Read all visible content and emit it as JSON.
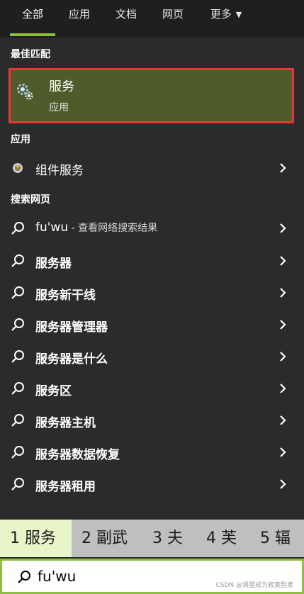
{
  "tabs": [
    {
      "label": "全部"
    },
    {
      "label": "应用"
    },
    {
      "label": "文档"
    },
    {
      "label": "网页"
    },
    {
      "label": "更多"
    }
  ],
  "sections": {
    "best_match": "最佳匹配",
    "apps": "应用",
    "web": "搜索网页"
  },
  "best_match": {
    "title": "服务",
    "subtitle": "应用"
  },
  "apps": [
    {
      "label": "组件服务"
    }
  ],
  "web_results": [
    {
      "label": "fu'wu",
      "hint": " - 查看网络搜索结果"
    },
    {
      "label": "服务器"
    },
    {
      "label": "服务新干线"
    },
    {
      "label": "服务器管理器"
    },
    {
      "label": "服务器是什么"
    },
    {
      "label": "服务区"
    },
    {
      "label": "服务器主机"
    },
    {
      "label": "服务器数据恢复"
    },
    {
      "label": "服务器租用"
    }
  ],
  "candidates": [
    {
      "text": "1 服务"
    },
    {
      "text": "2 副武"
    },
    {
      "text": "3 夫"
    },
    {
      "text": "4 芙"
    },
    {
      "text": "5 辐"
    }
  ],
  "search": {
    "value": "fu'wu"
  },
  "watermark": "CSDN @渴望成为寂寞胜者",
  "colors": {
    "accent": "#8fbf40",
    "highlight_border": "#e53935",
    "best_match_bg": "#4f5b2a"
  }
}
